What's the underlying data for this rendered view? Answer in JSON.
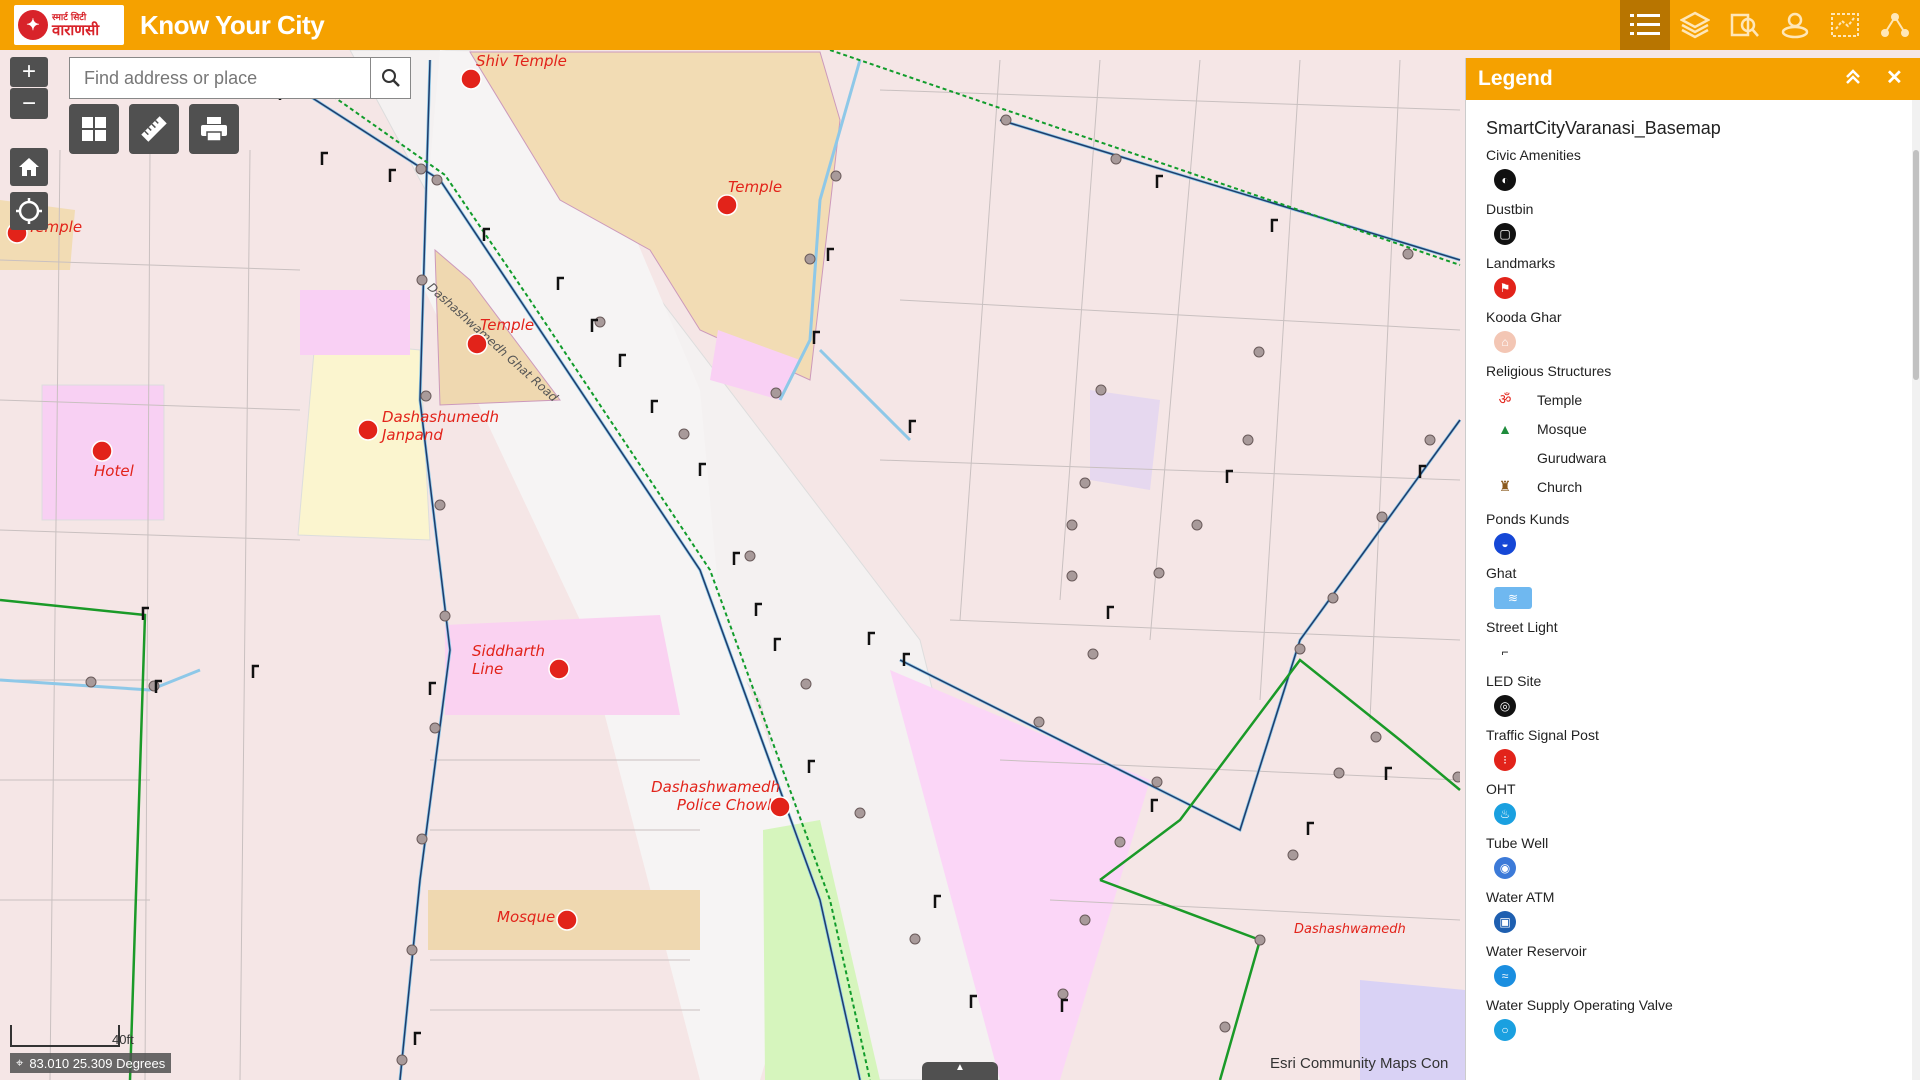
{
  "header": {
    "logo_top": "स्मार्ट सिटी",
    "logo_main": "वाराणसी",
    "title": "Know Your City",
    "tools": [
      "legend-list-icon",
      "layers-icon",
      "query-icon",
      "select-icon",
      "analysis-icon",
      "share-icon"
    ]
  },
  "search": {
    "placeholder": "Find address or place"
  },
  "map_labels": {
    "shiv_temple": "Shiv Temple",
    "temple_1": "Temple",
    "temple_2": "Temple",
    "temple_3": "Temple",
    "janpand": "Dashashumedh Janpand",
    "hotel": "Hotel",
    "siddharth": "Siddharth Line",
    "police": "Dashashwamedh Police Chowki",
    "mosque": "Mosque",
    "dashashwamedh": "Dashashwamedh",
    "road": "Dashashwamedh Ghat Road"
  },
  "legend": {
    "header": "Legend",
    "service": "SmartCityVaranasi_Basemap",
    "groups": [
      {
        "label": "Civic Amenities",
        "color": "#111111",
        "glyph": "◐"
      },
      {
        "label": "Dustbin",
        "color": "#111111",
        "glyph": "▢"
      },
      {
        "label": "Landmarks",
        "color": "#e2231a",
        "glyph": "⚑"
      },
      {
        "label": "Kooda Ghar",
        "color": "#f3c6b4",
        "glyph": "⌂"
      }
    ],
    "religious": {
      "label": "Religious Structures",
      "items": [
        {
          "label": "Temple",
          "glyph": "ॐ",
          "color": "#e2231a"
        },
        {
          "label": "Mosque",
          "glyph": "▲",
          "color": "#1e8c3c"
        },
        {
          "label": "Gurudwara",
          "glyph": "",
          "color": "#ffffff"
        },
        {
          "label": "Church",
          "glyph": "♜",
          "color": "#8b5a1e"
        }
      ]
    },
    "groups2": [
      {
        "label": "Ponds Kunds",
        "color": "#1547d6",
        "glyph": "◒"
      },
      {
        "label": "Ghat",
        "color": "#6fb8f0",
        "glyph": "≋",
        "wide": true
      },
      {
        "label": "Street Light",
        "color": "#ffffff",
        "glyph": "⌐",
        "dark": true
      },
      {
        "label": "LED Site",
        "color": "#111111",
        "glyph": "◎"
      },
      {
        "label": "Traffic Signal Post",
        "color": "#e2231a",
        "glyph": "⁝"
      },
      {
        "label": "OHT",
        "color": "#1aa0e0",
        "glyph": "♨"
      },
      {
        "label": "Tube Well",
        "color": "#3c7ad8",
        "glyph": "◉"
      },
      {
        "label": "Water ATM",
        "color": "#1e5fb0",
        "glyph": "▣"
      },
      {
        "label": "Water Reservoir",
        "color": "#1a8ee0",
        "glyph": "≈"
      },
      {
        "label": "Water Supply Operating Valve",
        "color": "#1aa0e0",
        "glyph": "○"
      }
    ]
  },
  "status": {
    "coords": "83.010 25.309 Degrees",
    "scale": "40ft",
    "attribution": "Esri Community Maps Con"
  }
}
